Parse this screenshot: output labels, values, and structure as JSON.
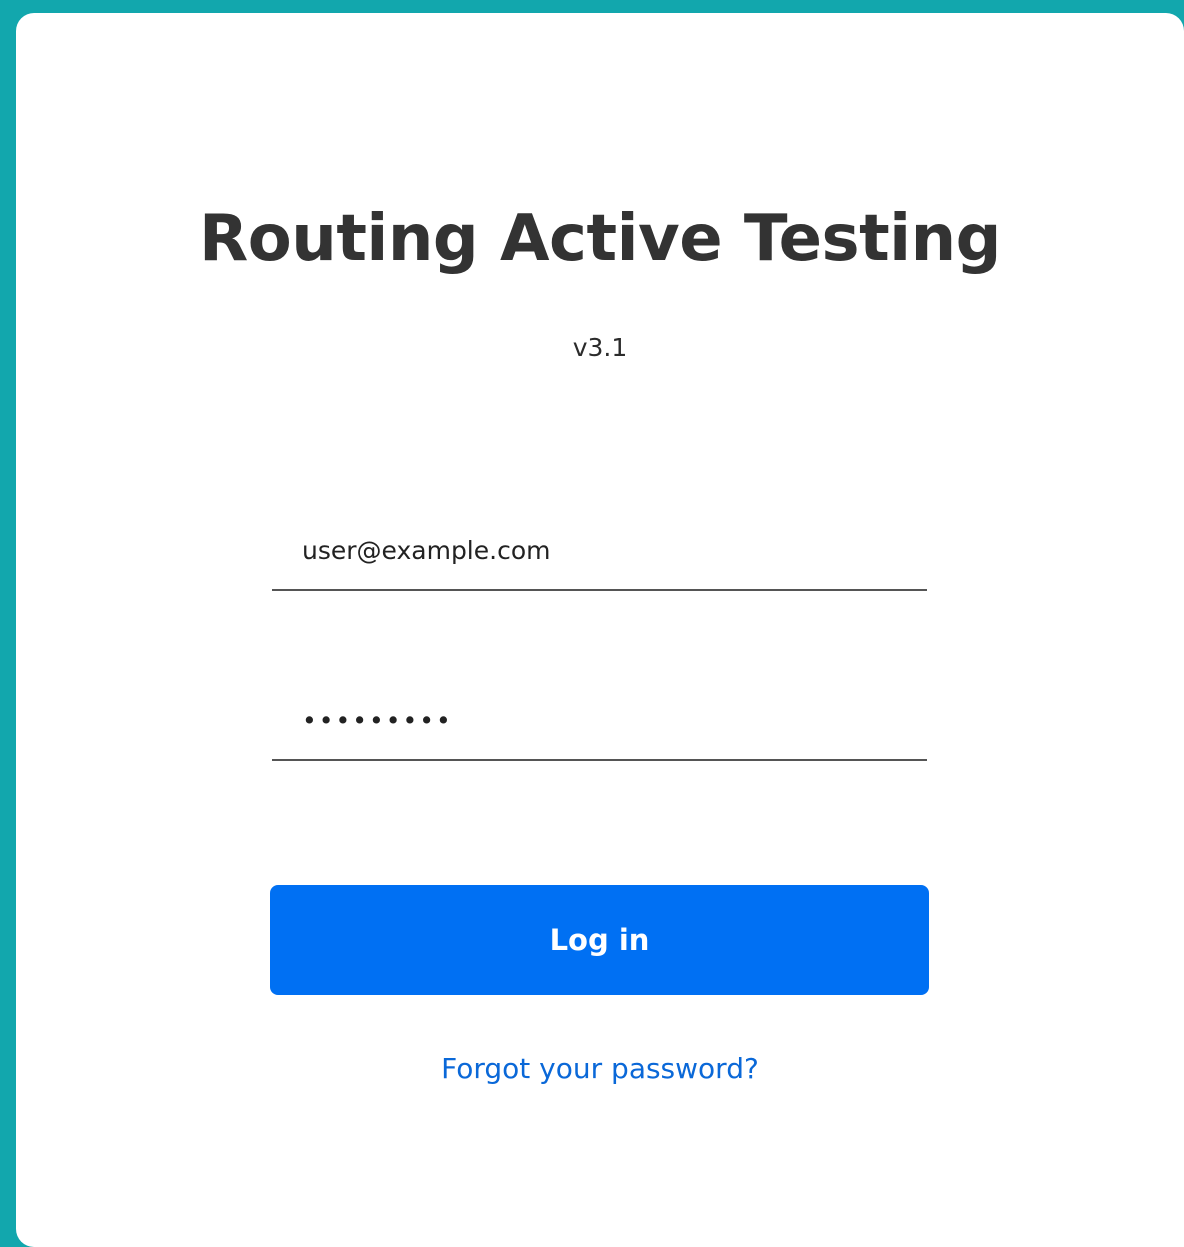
{
  "app": {
    "title": "Routing Active Testing",
    "version": "v3.1"
  },
  "login_form": {
    "email_value": "user@example.com",
    "password_value": "•••••••••",
    "login_label": "Log in",
    "forgot_password_label": "Forgot your password?"
  },
  "colors": {
    "background": "#12a7ad",
    "card": "#ffffff",
    "primary_button": "#0070f3",
    "link": "#0a68d8",
    "title_text": "#333333"
  }
}
